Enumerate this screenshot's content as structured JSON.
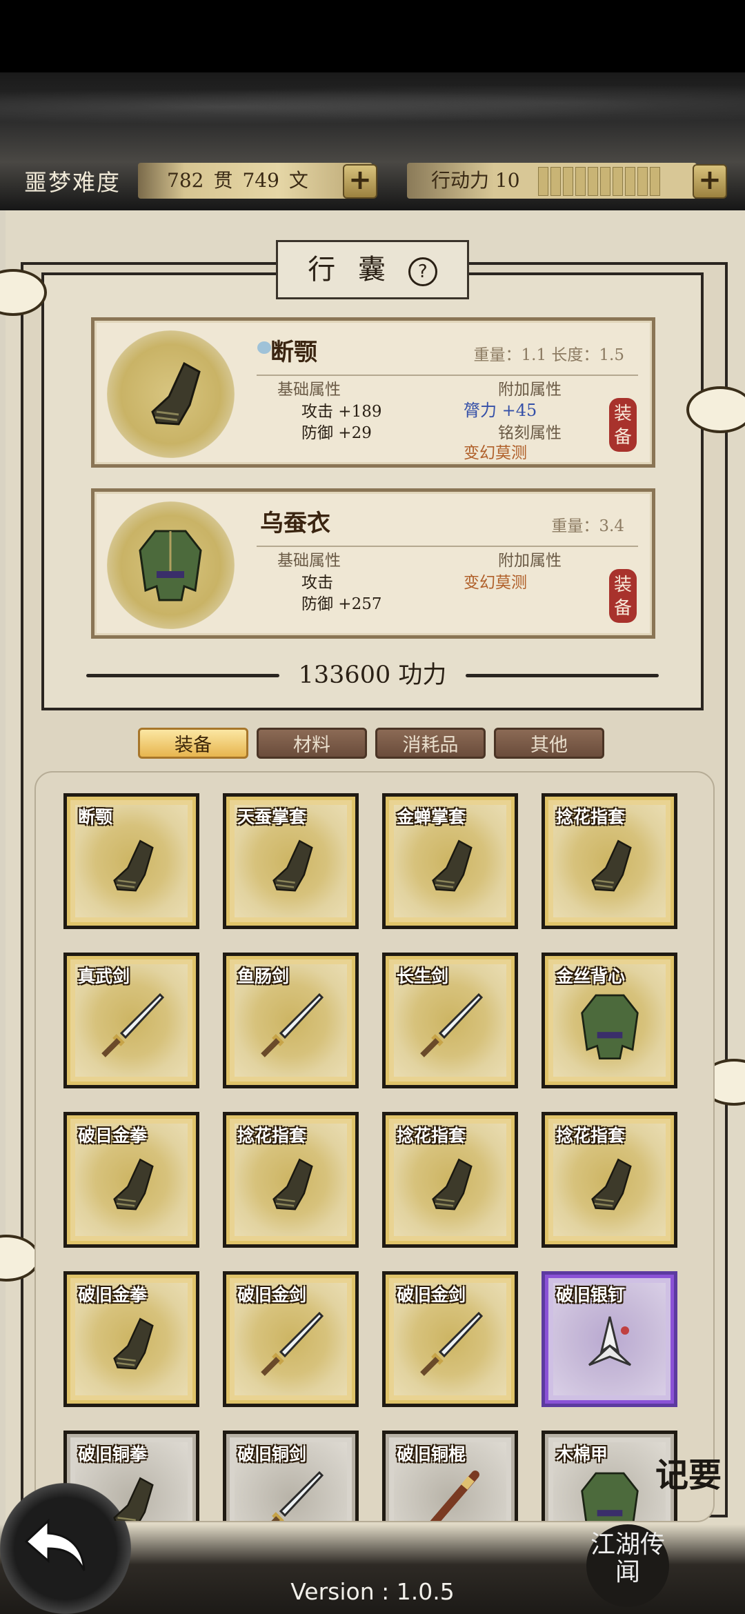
{
  "header": {
    "difficulty": "噩梦难度",
    "money": {
      "guan": "782",
      "guan_unit": "贯",
      "wen": "749",
      "wen_unit": "文"
    },
    "energy_label": "行动力",
    "energy_value": "10",
    "plus_label": "+"
  },
  "panel": {
    "title": "行 囊",
    "help_label": "?",
    "equipped": [
      {
        "name": "断颚",
        "weight_text": "重量：1.1  长度：1.5",
        "base_header": "基础属性",
        "extra_header": "附加属性",
        "attack": "攻击 +189",
        "defense": "防御 +29",
        "bonus": "膂力 +45",
        "engrave_header": "铭刻属性",
        "engrave": "变幻莫测",
        "equip_label": "装备",
        "icon": "gauntlet-icon"
      },
      {
        "name": "乌蚕衣",
        "weight_text": "重量：3.4",
        "base_header": "基础属性",
        "extra_header": "附加属性",
        "attack": "攻击",
        "defense": "防御 +257",
        "bonus": "变幻莫测",
        "equip_label": "装备",
        "icon": "armor-icon"
      }
    ],
    "power": "133600 功力"
  },
  "tabs": [
    {
      "label": "装备",
      "active": true
    },
    {
      "label": "材料",
      "active": false
    },
    {
      "label": "消耗品",
      "active": false
    },
    {
      "label": "其他",
      "active": false
    }
  ],
  "items": [
    {
      "name": "断颚",
      "icon": "gauntlet-icon",
      "rarity": "gold"
    },
    {
      "name": "天蚕掌套",
      "icon": "gauntlet-icon",
      "rarity": "gold"
    },
    {
      "name": "金蝉掌套",
      "icon": "gauntlet-icon",
      "rarity": "gold"
    },
    {
      "name": "捻花指套",
      "icon": "gauntlet-icon",
      "rarity": "gold"
    },
    {
      "name": "真武剑",
      "icon": "sword-icon",
      "rarity": "gold"
    },
    {
      "name": "鱼肠剑",
      "icon": "sword-icon",
      "rarity": "gold"
    },
    {
      "name": "长生剑",
      "icon": "sword-icon",
      "rarity": "gold"
    },
    {
      "name": "金丝背心",
      "icon": "armor-icon",
      "rarity": "gold"
    },
    {
      "name": "破日金拳",
      "icon": "gauntlet-icon",
      "rarity": "gold"
    },
    {
      "name": "捻花指套",
      "icon": "gauntlet-icon",
      "rarity": "gold"
    },
    {
      "name": "捻花指套",
      "icon": "gauntlet-icon",
      "rarity": "gold"
    },
    {
      "name": "捻花指套",
      "icon": "gauntlet-icon",
      "rarity": "gold"
    },
    {
      "name": "破旧金拳",
      "icon": "gauntlet-icon",
      "rarity": "gold"
    },
    {
      "name": "破旧金剑",
      "icon": "sword-icon",
      "rarity": "gold"
    },
    {
      "name": "破旧金剑",
      "icon": "sword-icon",
      "rarity": "gold"
    },
    {
      "name": "破旧银钉",
      "icon": "dart-icon",
      "rarity": "purple"
    },
    {
      "name": "破旧铜拳",
      "icon": "gauntlet-icon",
      "rarity": "gray"
    },
    {
      "name": "破旧铜剑",
      "icon": "sword-icon",
      "rarity": "gray"
    },
    {
      "name": "破旧铜棍",
      "icon": "staff-icon",
      "rarity": "gray"
    },
    {
      "name": "木棉甲",
      "icon": "armor-icon",
      "rarity": "gray"
    }
  ],
  "footer": {
    "version": "Version : 1.0.5",
    "jiyao": "记要",
    "jianghu": "江湖传闻"
  }
}
